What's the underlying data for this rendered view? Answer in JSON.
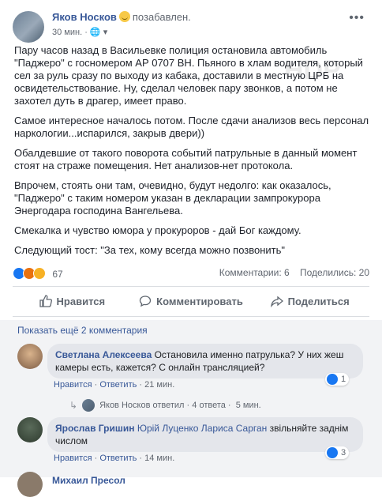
{
  "post": {
    "author": "Яков Носков",
    "activity": "позабавлен.",
    "time": "30 мин.",
    "watermark": "HDP",
    "paragraphs": [
      "Пару часов назад в Васильевке полиция остановила автомобиль \"Паджеро\" с госномером АР 0707 ВН. Пьяного в хлам водителя, который сел за руль сразу по выходу из кабака, доставили в местную ЦРБ на освидетельствование. Ну, сделал человек пару звонков, а потом не захотел дуть в драгер, имеет право.",
      "Самое интересное началось потом. После сдачи анализов весь персонал наркологии...испарился, закрыв двери))",
      "Обалдевшие от такого поворота событий патрульные в данный момент стоят на страже помещения. Нет анализов-нет протокола.",
      "Впрочем, стоять они там, очевидно, будут недолго: как оказалось, \"Паджеро\" с таким номером указан в декларации зампрокурора Энергодара господина Вангельева.",
      "Смекалка и чувство юмора у прокуроров - дай Бог каждому.",
      "Следующий тост: \"За тех, кому всегда можно позвонить\""
    ],
    "reactions_count": "67",
    "comments_count": "Комментарии: 6",
    "shares_count": "Поделились: 20",
    "actions": {
      "like": "Нравится",
      "comment": "Комментировать",
      "share": "Поделиться"
    }
  },
  "comments": {
    "show_more": "Показать ещё 2 комментария",
    "c1": {
      "name": "Светлана Алексеева",
      "text": "Остановила именно патрулька? У них жеш камеры есть, кажется? С онлайн трансляцией?",
      "like": "Нравится",
      "reply": "Ответить",
      "time": "21 мин.",
      "likes": "1"
    },
    "reply_summary": {
      "name": "Яков Носков",
      "verb": "ответил",
      "count": "4 ответа",
      "time": "5 мин."
    },
    "c2": {
      "name": "Ярослав Гришин",
      "tags": "Юрій Луценко Лариса Сарган",
      "text": "звільняйте заднім числом",
      "like": "Нравится",
      "reply": "Ответить",
      "time": "14 мин.",
      "likes": "3"
    },
    "c3": {
      "name": "Михаил Пресол"
    }
  },
  "colors": {
    "link": "#385898",
    "like": "#1877f2",
    "bg": "#f2f3f5"
  }
}
